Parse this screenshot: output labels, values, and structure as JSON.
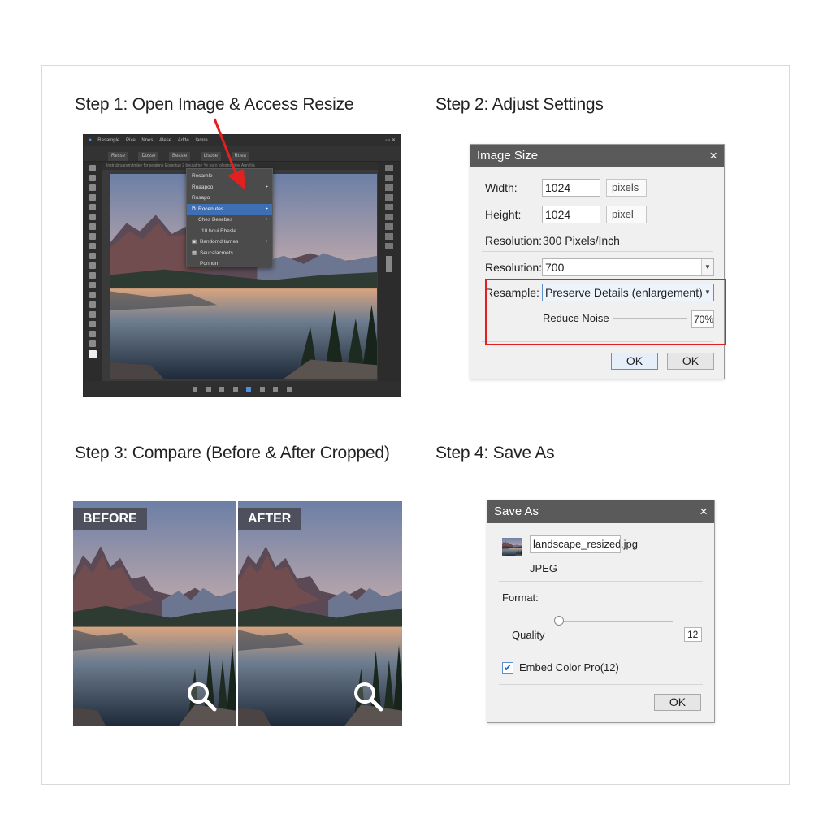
{
  "steps": {
    "step1": "Step 1: Open Image & Access Resize",
    "step2": "Step 2: Adjust Settings",
    "step3": "Step 3: Compare (Before & After Cropped)",
    "step4": "Step 4: Save As"
  },
  "editor": {
    "menu_items": [
      "Resample",
      "Pixe",
      "Nnes",
      "Alese",
      "Adde",
      "Iamre"
    ],
    "option_tabs": [
      "Resse",
      "Dosse",
      "Beasle",
      "Lisose",
      "Rttea"
    ],
    "ruler_text": "Instrubrsaremitmlee for seatune Eoue tue 2 beutalme Ye naro toleanshime Aun ltia",
    "context_menu": [
      {
        "label": "Resamle",
        "sub": false,
        "selected": false
      },
      {
        "label": "Roaapoo",
        "sub": true,
        "selected": false
      },
      {
        "label": "Rosapo",
        "sub": false,
        "selected": false
      },
      {
        "label": "Rocenutes",
        "sub": true,
        "selected": true
      },
      {
        "label": "Ches Besebes",
        "sub": true,
        "selected": false
      },
      {
        "label": "10 boui Ebesle",
        "sub": false,
        "selected": false
      },
      {
        "label": "Bandomd tames",
        "sub": true,
        "selected": false
      },
      {
        "label": "Seucalacmets",
        "sub": false,
        "selected": false
      },
      {
        "label": "Ponnum",
        "sub": false,
        "selected": false
      }
    ],
    "accent_color": "#e32020"
  },
  "image_size": {
    "title": "Image Size",
    "close_icon": "×",
    "width_label": "Width:",
    "width_value": "1024",
    "width_unit": "pixels",
    "height_label": "Height:",
    "height_value": "1024",
    "height_unit": "pixel",
    "resolution_info_label": "Resolution:",
    "resolution_info_value": "300 Pixels/Inch",
    "resolution_label": "Resolution:",
    "resolution_value": "700",
    "resample_label": "Resample:",
    "resample_value": "Preserve Details (enlargement)",
    "reduce_noise_label": "Reduce Noise",
    "reduce_noise_value": "70%",
    "ok_label": "OK",
    "ok2_label": "OK"
  },
  "compare": {
    "before_label": "BEFORE",
    "after_label": "AFTER"
  },
  "save_as": {
    "title": "Save As",
    "close_icon": "×",
    "filename": "landscape_resized",
    "extension": ".jpg",
    "file_type": "JPEG",
    "format_label": "Format:",
    "quality_label": "Quality",
    "quality_value": "12",
    "embed_label": "Embed Color Pro(12)",
    "embed_checked": true,
    "ok_label": "OK"
  }
}
